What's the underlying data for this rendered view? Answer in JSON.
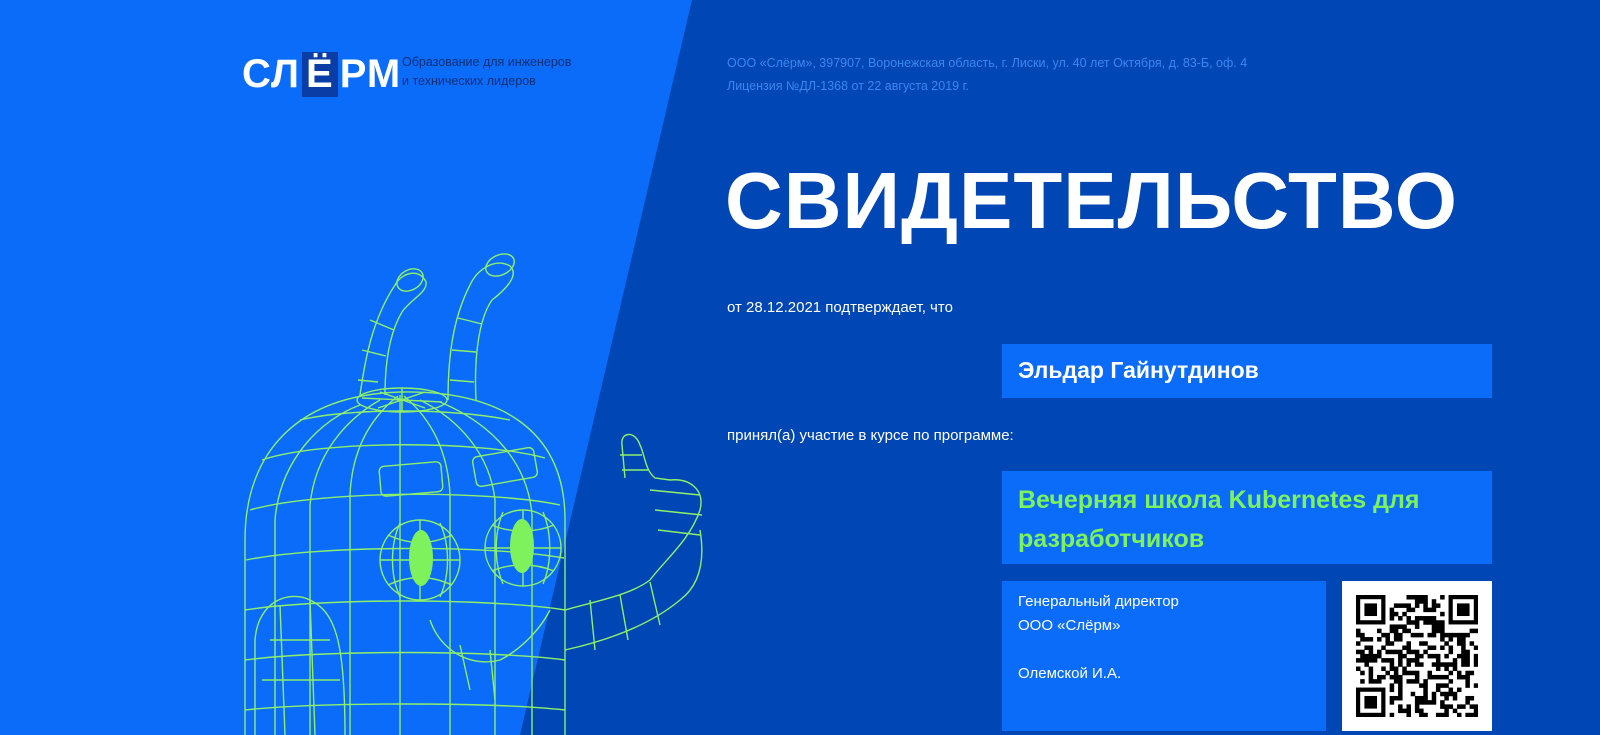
{
  "logo": {
    "part1": "СЛ",
    "part2": "Ё",
    "part3": "РМ"
  },
  "tagline": {
    "line1": "Образование для инженеров",
    "line2": "и технических лидеров"
  },
  "org": {
    "address": "ООО «Слёрм», 397907, Воронежская область, г. Лиски, ул. 40 лет Октября, д. 83-Б, оф. 4",
    "license": "Лицензия №ДЛ-1368 от 22 августа 2019 г."
  },
  "certificate": {
    "title": "СВИДЕТЕЛЬСТВО",
    "confirm_text": "от 28.12.2021 подтверждает, что",
    "recipient": "Эльдар Гайнутдинов",
    "participation_text": "принял(а) участие в курсе по программе:",
    "course": "Вечерняя школа Kubernetes для разработчиков"
  },
  "signature": {
    "position": "Генеральный директор",
    "company": "ООО «Слёрм»",
    "person": "Олемской И.А."
  },
  "colors": {
    "background_dark": "#0046b4",
    "background_light": "#0a6cf8",
    "accent_green": "#7ef25c",
    "text_white": "#ffffff"
  },
  "icons": {
    "mascot": "robot-mascot-illustration",
    "qr": "qr-code"
  }
}
